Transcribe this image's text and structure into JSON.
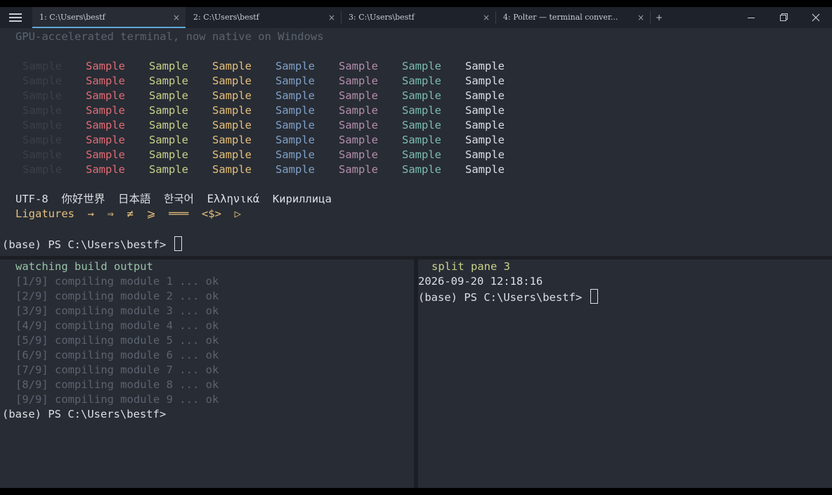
{
  "tabs": [
    {
      "label": "1: C:\\Users\\bestf",
      "close": "×"
    },
    {
      "label": "2: C:\\Users\\bestf",
      "close": "×"
    },
    {
      "label": "3: C:\\Users\\bestf",
      "close": "×"
    },
    {
      "label": "4: Polter — terminal conver...",
      "close": "×"
    }
  ],
  "new_tab": "+",
  "colors": {
    "background": "#282c34",
    "titlebar": "#1e222a",
    "active_tab_accent": "#5ea7d6",
    "dim": "#5c6370",
    "fg": "#dcdfe4",
    "red": "#e06c75",
    "green": "#c8d28a",
    "yellow": "#e5c07b",
    "blue": "#7fa1c9",
    "magenta": "#b48ead",
    "cyan": "#7cbcb0",
    "white": "#dcdfe4",
    "black_sample": "#3b4048",
    "ligature": "#e5c07b",
    "green_text": "#98c3a8"
  },
  "pane1": {
    "banner": "GPU-accelerated terminal, now native on Windows",
    "sample_word": "Sample",
    "sample_rows": 8,
    "sample_columns": [
      "black",
      "red",
      "green",
      "yellow",
      "blue",
      "magenta",
      "cyan",
      "white"
    ],
    "unicode_line": "UTF-8  你好世界  日本語  한국어  Ελληνικά  Кириллица",
    "ligatures_line": "Ligatures  →  ⇒  ≠  ⩾  ═══  <$>  ▷",
    "prompt": "(base) PS C:\\Users\\bestf> "
  },
  "pane2": {
    "header": "watching build output",
    "lines": [
      "[1/9] compiling module 1 ... ok",
      "[2/9] compiling module 2 ... ok",
      "[3/9] compiling module 3 ... ok",
      "[4/9] compiling module 4 ... ok",
      "[5/9] compiling module 5 ... ok",
      "[6/9] compiling module 6 ... ok",
      "[7/9] compiling module 7 ... ok",
      "[8/9] compiling module 8 ... ok",
      "[9/9] compiling module 9 ... ok"
    ],
    "prompt": "(base) PS C:\\Users\\bestf>"
  },
  "pane3": {
    "header": "split pane 3",
    "timestamp": "2026-09-20 12:18:16",
    "prompt": "(base) PS C:\\Users\\bestf> "
  }
}
